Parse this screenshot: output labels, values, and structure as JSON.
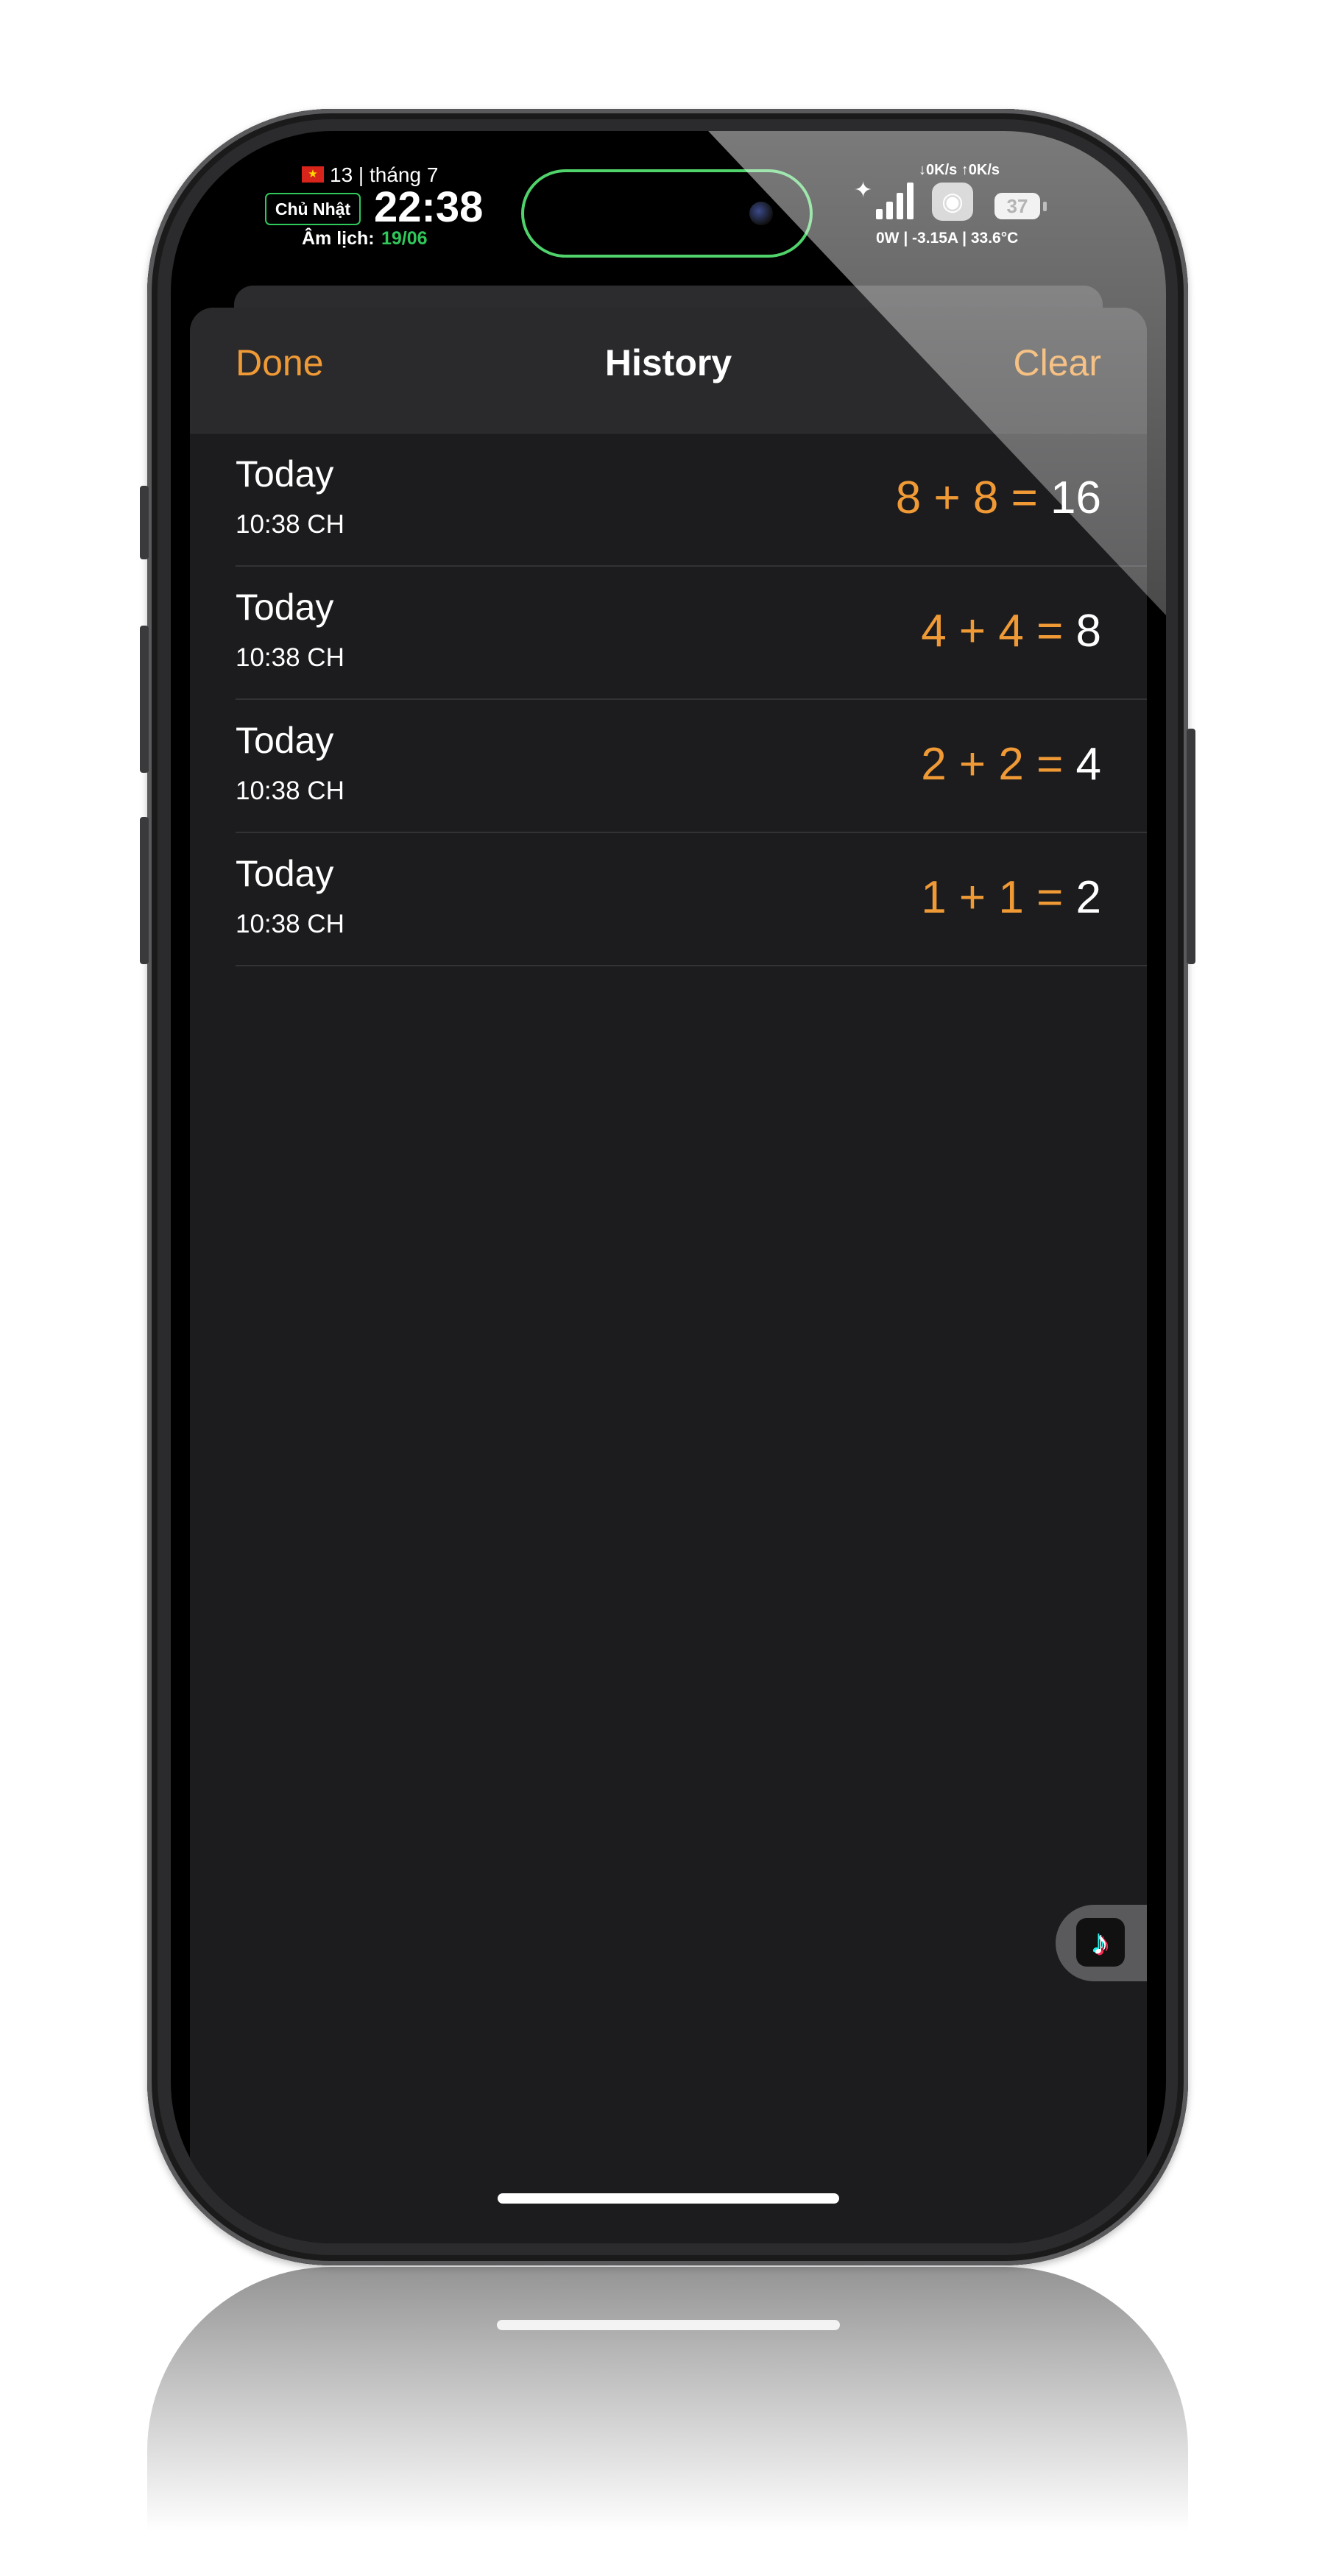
{
  "status_bar": {
    "date_line": "13 | tháng 7",
    "weekday": "Chủ Nhật",
    "time": "22:38",
    "lunar_label": "Âm lịch:",
    "lunar_date": "19/06",
    "net_speed": "↓0K/s ↑0K/s",
    "battery_level": "37",
    "stats": "0W | -3.15A | 33.6°C",
    "flag_icon": "vietnam-flag-icon",
    "colors": {
      "accent_green": "#30c85a",
      "island_border": "#4fd36a"
    }
  },
  "sheet": {
    "done_label": "Done",
    "title": "History",
    "clear_label": "Clear",
    "accent_color": "#f09a36"
  },
  "history": [
    {
      "day": "Today",
      "time": "10:38 CH",
      "expression": "8 + 8 =",
      "result": "16"
    },
    {
      "day": "Today",
      "time": "10:38 CH",
      "expression": "4 + 4 =",
      "result": "8"
    },
    {
      "day": "Today",
      "time": "10:38 CH",
      "expression": "2 + 2 =",
      "result": "4"
    },
    {
      "day": "Today",
      "time": "10:38 CH",
      "expression": "1 + 1 =",
      "result": "2"
    }
  ],
  "floating": {
    "app_icon": "tiktok-icon"
  }
}
